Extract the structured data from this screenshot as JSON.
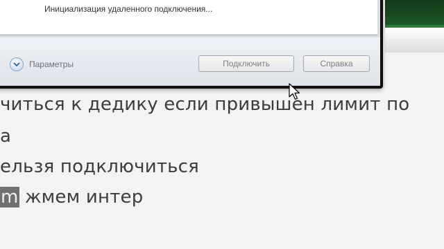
{
  "dialog": {
    "status_text": "Инициализация удаленного подключения...",
    "options_label": "Параметры",
    "connect_label": "Подключить",
    "help_label": "Справка"
  },
  "document": {
    "line1": "читься к дедику если привышен лимит по",
    "line2": "а",
    "line3": "ельзя подключиться",
    "line4_highlight": "m",
    "line4_rest": " жмем интер"
  }
}
